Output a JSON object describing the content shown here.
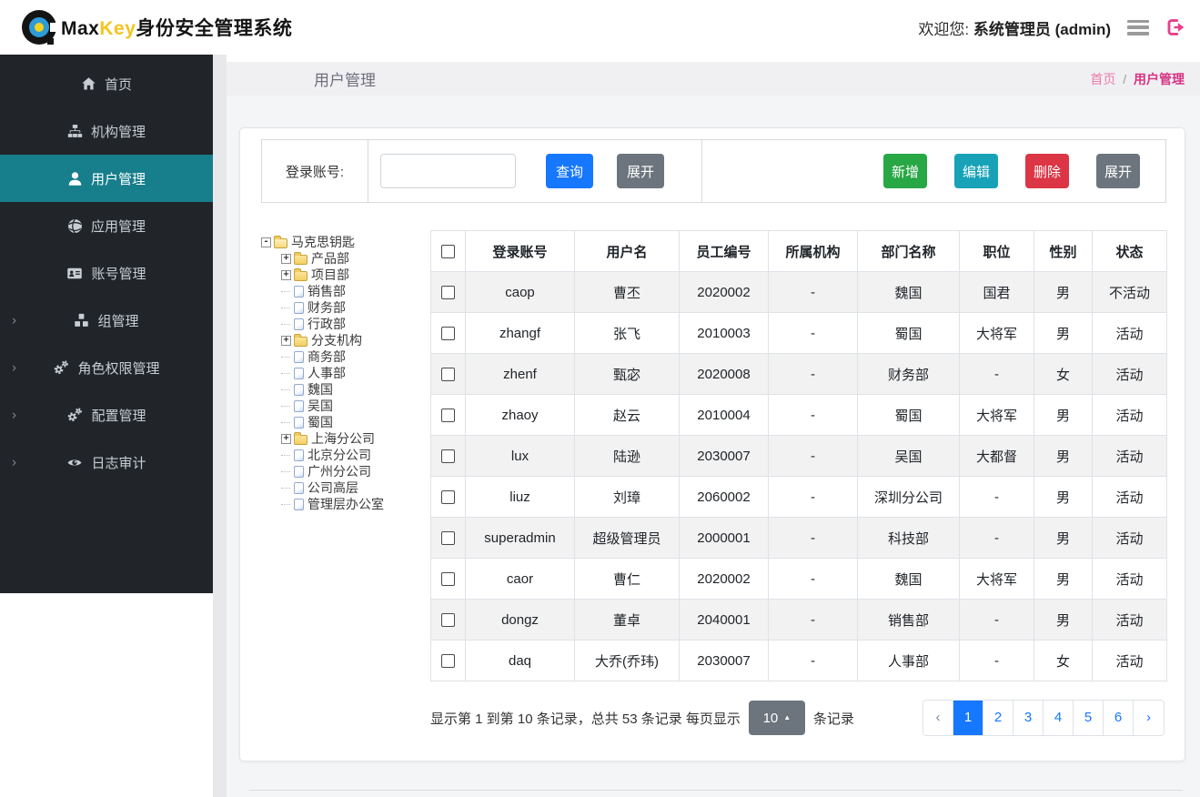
{
  "header": {
    "brand": {
      "max": "Max",
      "key": "Key",
      "suffix": "身份安全管理系统"
    },
    "welcome_label": "欢迎您:",
    "welcome_user": "系统管理员 (admin)"
  },
  "sidebar": {
    "items": [
      {
        "label": "首页",
        "icon": "home-icon",
        "active": false,
        "expandable": false
      },
      {
        "label": "机构管理",
        "icon": "sitemap-icon",
        "active": false,
        "expandable": false
      },
      {
        "label": "用户管理",
        "icon": "user-icon",
        "active": true,
        "expandable": false
      },
      {
        "label": "应用管理",
        "icon": "globe-icon",
        "active": false,
        "expandable": false
      },
      {
        "label": "账号管理",
        "icon": "id-card-icon",
        "active": false,
        "expandable": false
      },
      {
        "label": "组管理",
        "icon": "cubes-icon",
        "active": false,
        "expandable": true
      },
      {
        "label": "角色权限管理",
        "icon": "gears-icon",
        "active": false,
        "expandable": true
      },
      {
        "label": "配置管理",
        "icon": "gears-icon",
        "active": false,
        "expandable": true
      },
      {
        "label": "日志审计",
        "icon": "eye-icon",
        "active": false,
        "expandable": true
      }
    ]
  },
  "page": {
    "title": "用户管理",
    "breadcrumb": {
      "home": "首页",
      "separator": "/",
      "current": "用户管理"
    }
  },
  "search": {
    "label": "登录账号:",
    "input_value": "",
    "query_label": "查询",
    "expand_label": "展开"
  },
  "actions": {
    "add": "新增",
    "edit": "编辑",
    "delete": "删除",
    "expand": "展开"
  },
  "tree": {
    "items": [
      {
        "label": "马克思钥匙",
        "icon": "folder-open-icon",
        "expander": "-",
        "level": 0
      },
      {
        "label": "产品部",
        "icon": "folder-icon",
        "expander": "+",
        "level": 1
      },
      {
        "label": "项目部",
        "icon": "folder-icon",
        "expander": "+",
        "level": 1
      },
      {
        "label": "销售部",
        "icon": "file-icon",
        "expander": "",
        "level": 1
      },
      {
        "label": "财务部",
        "icon": "file-icon",
        "expander": "",
        "level": 1
      },
      {
        "label": "行政部",
        "icon": "file-icon",
        "expander": "",
        "level": 1
      },
      {
        "label": "分支机构",
        "icon": "folder-icon",
        "expander": "+",
        "level": 1
      },
      {
        "label": "商务部",
        "icon": "file-icon",
        "expander": "",
        "level": 1
      },
      {
        "label": "人事部",
        "icon": "file-icon",
        "expander": "",
        "level": 1
      },
      {
        "label": "魏国",
        "icon": "file-icon",
        "expander": "",
        "level": 1
      },
      {
        "label": "吴国",
        "icon": "file-icon",
        "expander": "",
        "level": 1
      },
      {
        "label": "蜀国",
        "icon": "file-icon",
        "expander": "",
        "level": 1
      },
      {
        "label": "上海分公司",
        "icon": "folder-icon",
        "expander": "+",
        "level": 1
      },
      {
        "label": "北京分公司",
        "icon": "file-icon",
        "expander": "",
        "level": 1
      },
      {
        "label": "广州分公司",
        "icon": "file-icon",
        "expander": "",
        "level": 1
      },
      {
        "label": "公司高层",
        "icon": "file-icon",
        "expander": "",
        "level": 1
      },
      {
        "label": "管理层办公室",
        "icon": "file-icon",
        "expander": "",
        "level": 1
      }
    ]
  },
  "table": {
    "columns": [
      "登录账号",
      "用户名",
      "员工编号",
      "所属机构",
      "部门名称",
      "职位",
      "性别",
      "状态"
    ],
    "rows": [
      [
        "caop",
        "曹丕",
        "2020002",
        "-",
        "魏国",
        "国君",
        "男",
        "不活动"
      ],
      [
        "zhangf",
        "张飞",
        "2010003",
        "-",
        "蜀国",
        "大将军",
        "男",
        "活动"
      ],
      [
        "zhenf",
        "甄宓",
        "2020008",
        "-",
        "财务部",
        "-",
        "女",
        "活动"
      ],
      [
        "zhaoy",
        "赵云",
        "2010004",
        "-",
        "蜀国",
        "大将军",
        "男",
        "活动"
      ],
      [
        "lux",
        "陆逊",
        "2030007",
        "-",
        "吴国",
        "大都督",
        "男",
        "活动"
      ],
      [
        "liuz",
        "刘璋",
        "2060002",
        "-",
        "深圳分公司",
        "-",
        "男",
        "活动"
      ],
      [
        "superadmin",
        "超级管理员",
        "2000001",
        "-",
        "科技部",
        "-",
        "男",
        "活动"
      ],
      [
        "caor",
        "曹仁",
        "2020002",
        "-",
        "魏国",
        "大将军",
        "男",
        "活动"
      ],
      [
        "dongz",
        "董卓",
        "2040001",
        "-",
        "销售部",
        "-",
        "男",
        "活动"
      ],
      [
        "daq",
        "大乔(乔玮)",
        "2030007",
        "-",
        "人事部",
        "-",
        "女",
        "活动"
      ]
    ]
  },
  "pagination": {
    "summary": "显示第 1 到第 10 条记录，总共 53 条记录  每页显示",
    "page_size": "10",
    "caret": "▲",
    "suffix": "条记录",
    "prev": "‹",
    "next": "›",
    "pages": [
      "1",
      "2",
      "3",
      "4",
      "5",
      "6"
    ],
    "active_page": "1"
  },
  "colors": {
    "primary_blue": "#1677ff",
    "success_green": "#28a745",
    "info_teal": "#17a2b8",
    "danger_red": "#dc3545",
    "secondary_gray": "#6c757d",
    "sidebar_bg": "#212529",
    "sidebar_active_teal": "#177e8c",
    "brand_yellow": "#f5c51d",
    "link_pink": "#e83e8c",
    "breadcrumb_current_pink": "#d63384"
  }
}
